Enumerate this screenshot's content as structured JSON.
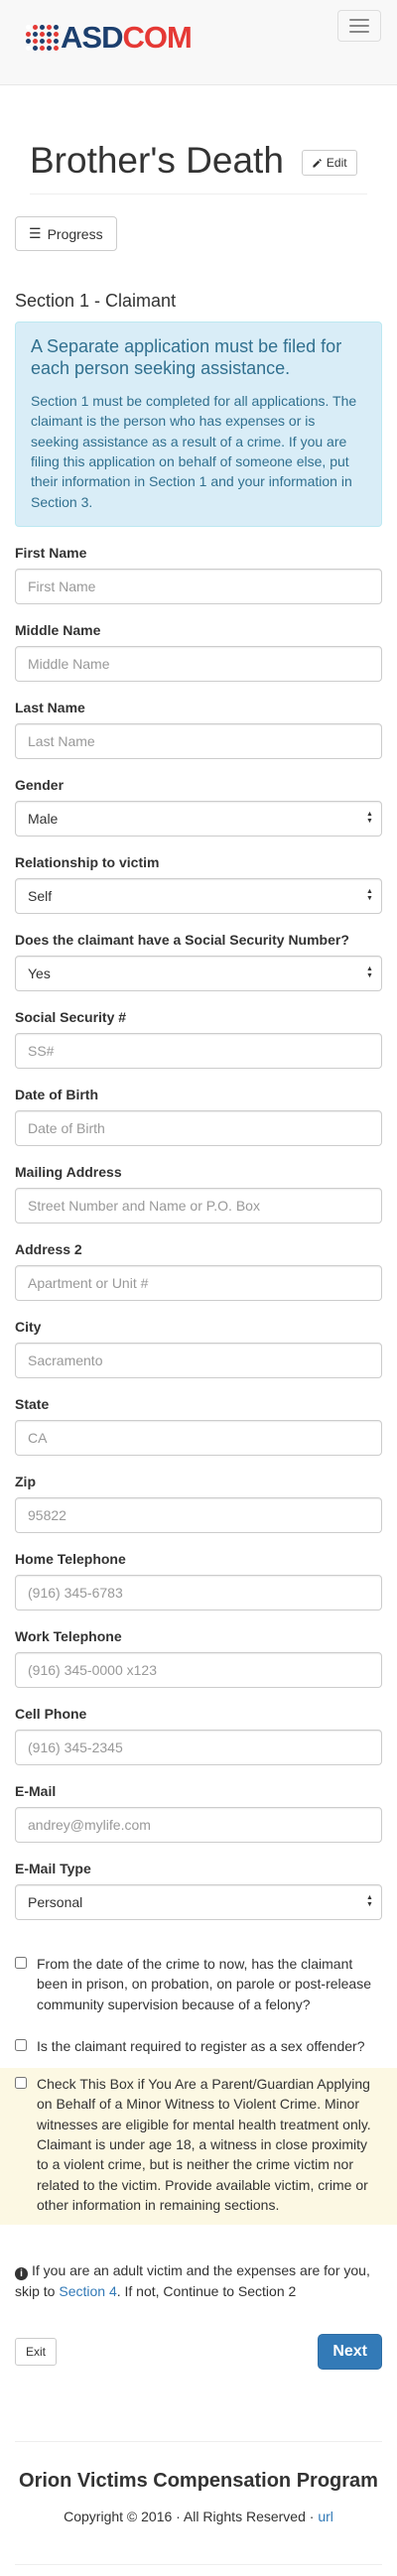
{
  "brand": {
    "logo_left": "ASD",
    "logo_right": "COM",
    "colors": {
      "dark": "#1c3f6e",
      "red": "#e53935"
    }
  },
  "header": {
    "title": "Brother's Death",
    "edit_label": "Edit",
    "progress_label": "Progress"
  },
  "section": {
    "title": "Section 1 - Claimant",
    "alert_heading": "A Separate application must be filed for each person seeking assistance.",
    "alert_body": "Section 1 must be completed for all applications. The claimant is the person who has expenses or is seeking assistance as a result of a crime. If you are filing this application on behalf of someone else, put their information in Section 1 and your information in Section 3."
  },
  "fields": {
    "first_name": {
      "label": "First Name",
      "placeholder": "First Name"
    },
    "middle_name": {
      "label": "Middle Name",
      "placeholder": "Middle Name"
    },
    "last_name": {
      "label": "Last Name",
      "placeholder": "Last Name"
    },
    "gender": {
      "label": "Gender",
      "value": "Male"
    },
    "relationship": {
      "label": "Relationship to victim",
      "value": "Self"
    },
    "has_ssn": {
      "label": "Does the claimant have a Social Security Number?",
      "value": "Yes"
    },
    "ssn": {
      "label": "Social Security #",
      "placeholder": "SS#"
    },
    "dob": {
      "label": "Date of Birth",
      "placeholder": "Date of Birth"
    },
    "mailing": {
      "label": "Mailing Address",
      "placeholder": "Street Number and Name or P.O. Box"
    },
    "address2": {
      "label": "Address 2",
      "placeholder": "Apartment or Unit #"
    },
    "city": {
      "label": "City",
      "placeholder": "Sacramento"
    },
    "state": {
      "label": "State",
      "placeholder": "CA"
    },
    "zip": {
      "label": "Zip",
      "placeholder": "95822"
    },
    "home_phone": {
      "label": "Home Telephone",
      "placeholder": "(916) 345-6783"
    },
    "work_phone": {
      "label": "Work Telephone",
      "placeholder": "(916) 345-0000 x123"
    },
    "cell_phone": {
      "label": "Cell Phone",
      "placeholder": "(916) 345-2345"
    },
    "email": {
      "label": "E-Mail",
      "placeholder": "andrey@mylife.com"
    },
    "email_type": {
      "label": "E-Mail Type",
      "value": "Personal"
    }
  },
  "checkboxes": {
    "prison": "From the date of the crime to now, has the claimant been in prison, on probation, on parole or post-release community supervision because of a felony?",
    "sex_offender": "Is the claimant required to register as a sex offender?",
    "minor_witness": "Check This Box if You Are a Parent/Guardian Applying on Behalf of a Minor Witness to Violent Crime. Minor witnesses are eligible for mental health treatment only. Claimant is under age 18, a witness in close proximity to a violent crime, but is neither the crime victim nor related to the victim. Provide available victim, crime or other information in remaining sections."
  },
  "info": {
    "before": "If you are an adult victim and the expenses are for you, skip to ",
    "link": "Section 4",
    "after": ". If not, Continue to Section 2"
  },
  "actions": {
    "exit_label": "Exit",
    "next_label": "Next"
  },
  "footer": {
    "title": "Orion Victims Compensation Program",
    "copyright": "Copyright © 2016 · All Rights Reserved · ",
    "link": "url"
  }
}
